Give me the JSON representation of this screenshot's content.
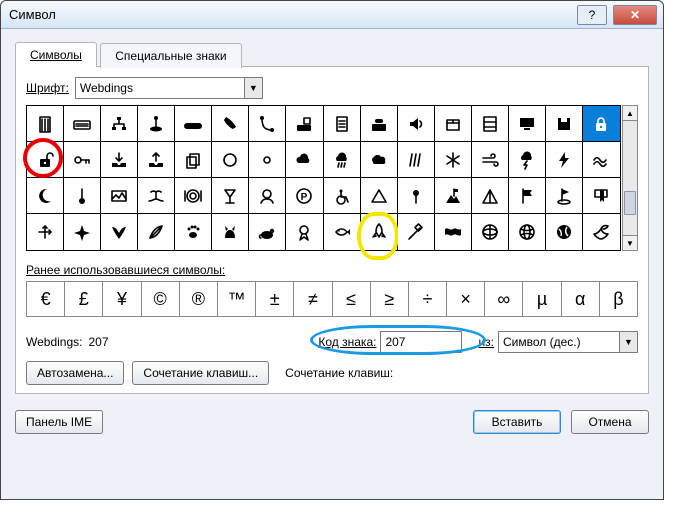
{
  "window": {
    "title": "Символ"
  },
  "tabs": {
    "symbols": "Символы",
    "special": "Специальные знаки"
  },
  "font": {
    "label": "Шрифт:",
    "value": "Webdings"
  },
  "glyphs": [
    "building",
    "keyboard",
    "network",
    "joystick",
    "gamepad",
    "phone-handset",
    "phone-hook",
    "fax",
    "page",
    "phone-desk",
    "speaker",
    "package",
    "bookcase",
    "computer",
    "save-disk",
    "padlock",
    "padlock-open",
    "key-old",
    "inbox",
    "outbox",
    "pages-stack",
    "circle",
    "circle-small",
    "clouds",
    "clouds-rain",
    "clouds-heavy",
    "rain",
    "snow",
    "wind",
    "storm",
    "lightning",
    "wave",
    "moon",
    "thermometer",
    "landscape",
    "island",
    "dinner-plate",
    "cocktail-glass",
    "dining",
    "parking",
    "wheelchair",
    "triangle-up",
    "pushpin",
    "mountain-flag",
    "tent",
    "flag",
    "golf-flag",
    "bookmark",
    "axes",
    "airplane",
    "bird-dive",
    "feather",
    "paw-print",
    "cat",
    "dog",
    "award",
    "fish",
    "rocket",
    "syringe",
    "world-map",
    "globe-1",
    "globe-2",
    "globe-3",
    "dove"
  ],
  "selected_glyph_index": 15,
  "annotations": {
    "red_circle_index": 16,
    "yellow_circle_index": 57
  },
  "recent": {
    "label": "Ранее использовавшиеся символы:",
    "items": [
      "€",
      "£",
      "¥",
      "©",
      "®",
      "™",
      "±",
      "≠",
      "≤",
      "≥",
      "÷",
      "×",
      "∞",
      "µ",
      "α",
      "β"
    ]
  },
  "info": {
    "name_label": "Webdings:",
    "name_value": "207",
    "code_label": "Код знака:",
    "code_value": "207",
    "from_label": "из:",
    "from_value": "Символ (дес.)"
  },
  "buttons": {
    "autocorrect": "Автозамена...",
    "shortcut_key": "Сочетание клавиш...",
    "shortcut_current_label": "Сочетание клавиш:"
  },
  "footer": {
    "ime_panel": "Панель IME",
    "insert": "Вставить",
    "cancel": "Отмена"
  }
}
